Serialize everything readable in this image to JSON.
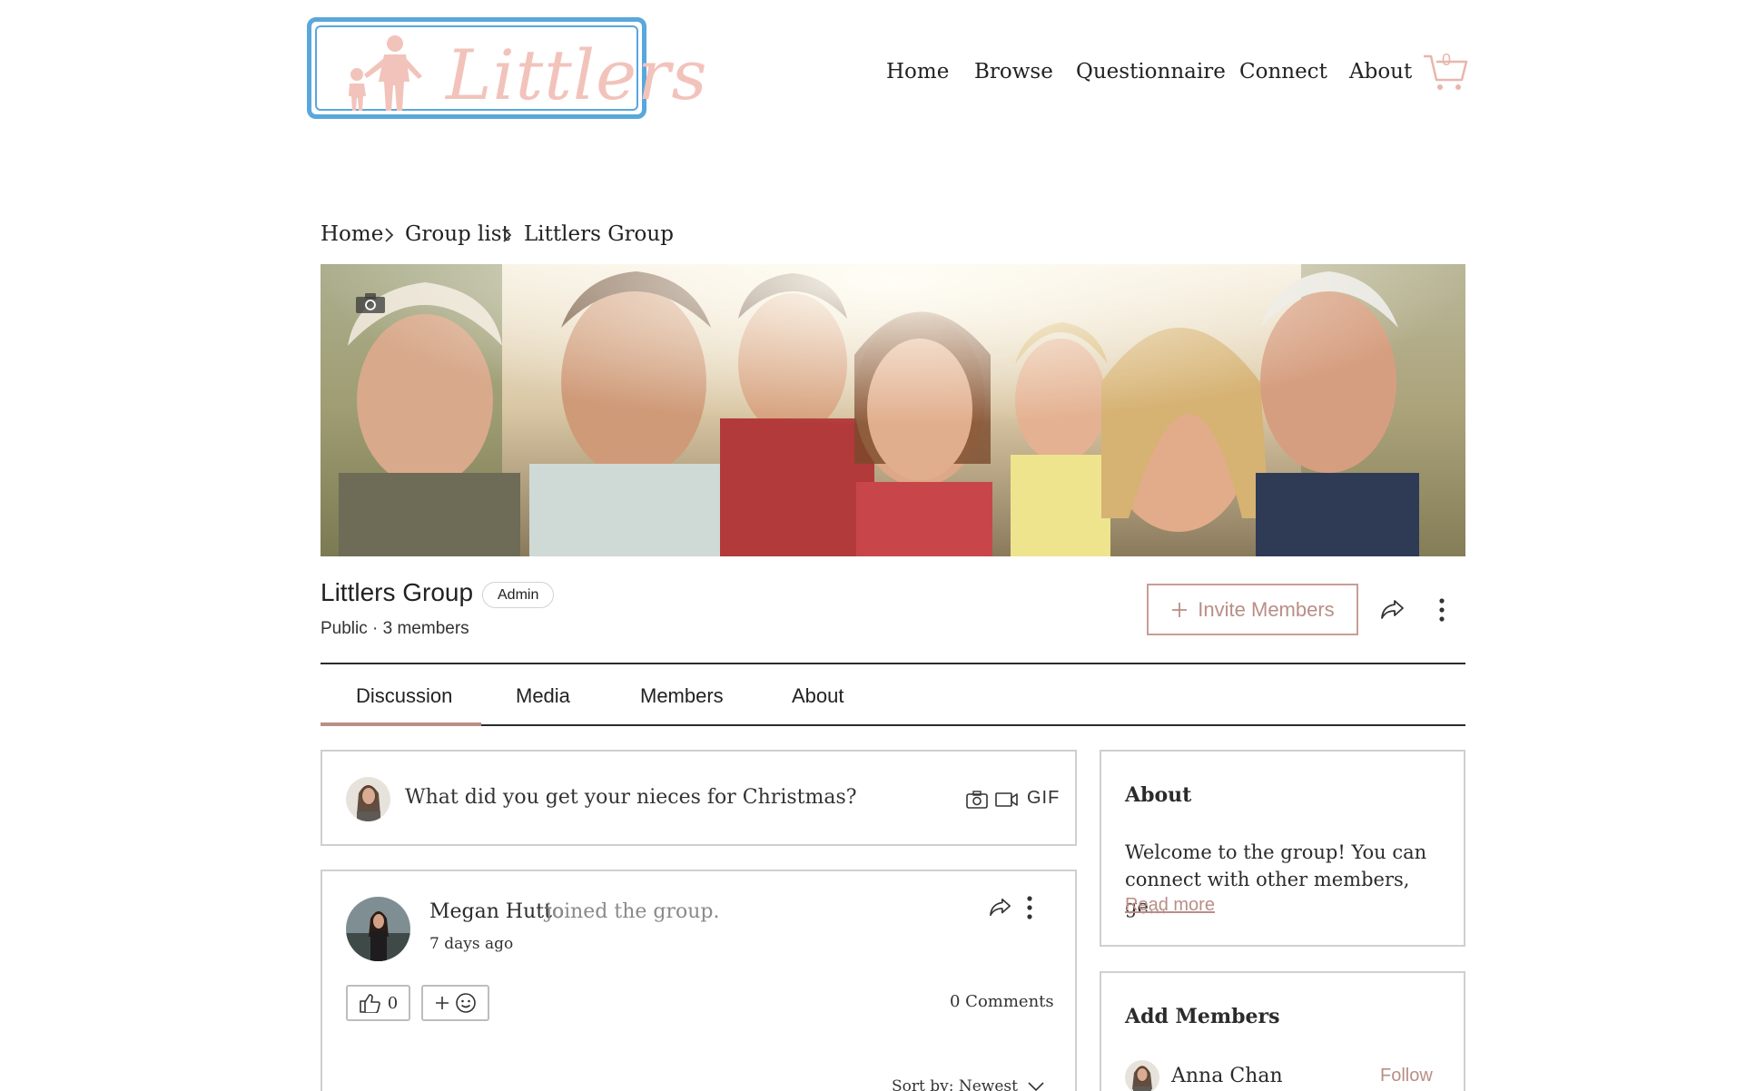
{
  "brand": {
    "logo_text": "Littlers",
    "accent": "#b98e86",
    "logo_border": "#5aa7dc",
    "logo_text_color": "#f2c3bb"
  },
  "nav": {
    "items": [
      {
        "label": "Home"
      },
      {
        "label": "Browse"
      },
      {
        "label": "Questionnaire"
      },
      {
        "label": "Connect"
      },
      {
        "label": "About"
      }
    ],
    "cart_count": "0",
    "cart_icon": "cart-icon"
  },
  "breadcrumb": {
    "items": [
      "Home",
      "Group list",
      "Littlers Group"
    ]
  },
  "group": {
    "title": "Littlers Group",
    "role_badge": "Admin",
    "meta": "Public · 3 members",
    "invite_label": "Invite Members",
    "cover_icon": "camera-icon"
  },
  "tabs": [
    {
      "label": "Discussion",
      "active": true
    },
    {
      "label": "Media",
      "active": false
    },
    {
      "label": "Members",
      "active": false
    },
    {
      "label": "About",
      "active": false
    }
  ],
  "composer": {
    "prompt": "What did you get your nieces for Christmas?",
    "gif_label": "GIF"
  },
  "post": {
    "author": "Megan Hutto",
    "action": "joined the group.",
    "time": "7 days ago",
    "likes": "0",
    "comments": "0 Comments",
    "sort": "Sort by: Newest"
  },
  "sidebar": {
    "about": {
      "title": "About",
      "text": "Welcome to the group! You can connect with other members, ge...",
      "read_more": "Read more"
    },
    "add_members": {
      "title": "Add Members",
      "members": [
        {
          "name": "Anna Chan",
          "action": "Follow"
        }
      ]
    }
  }
}
